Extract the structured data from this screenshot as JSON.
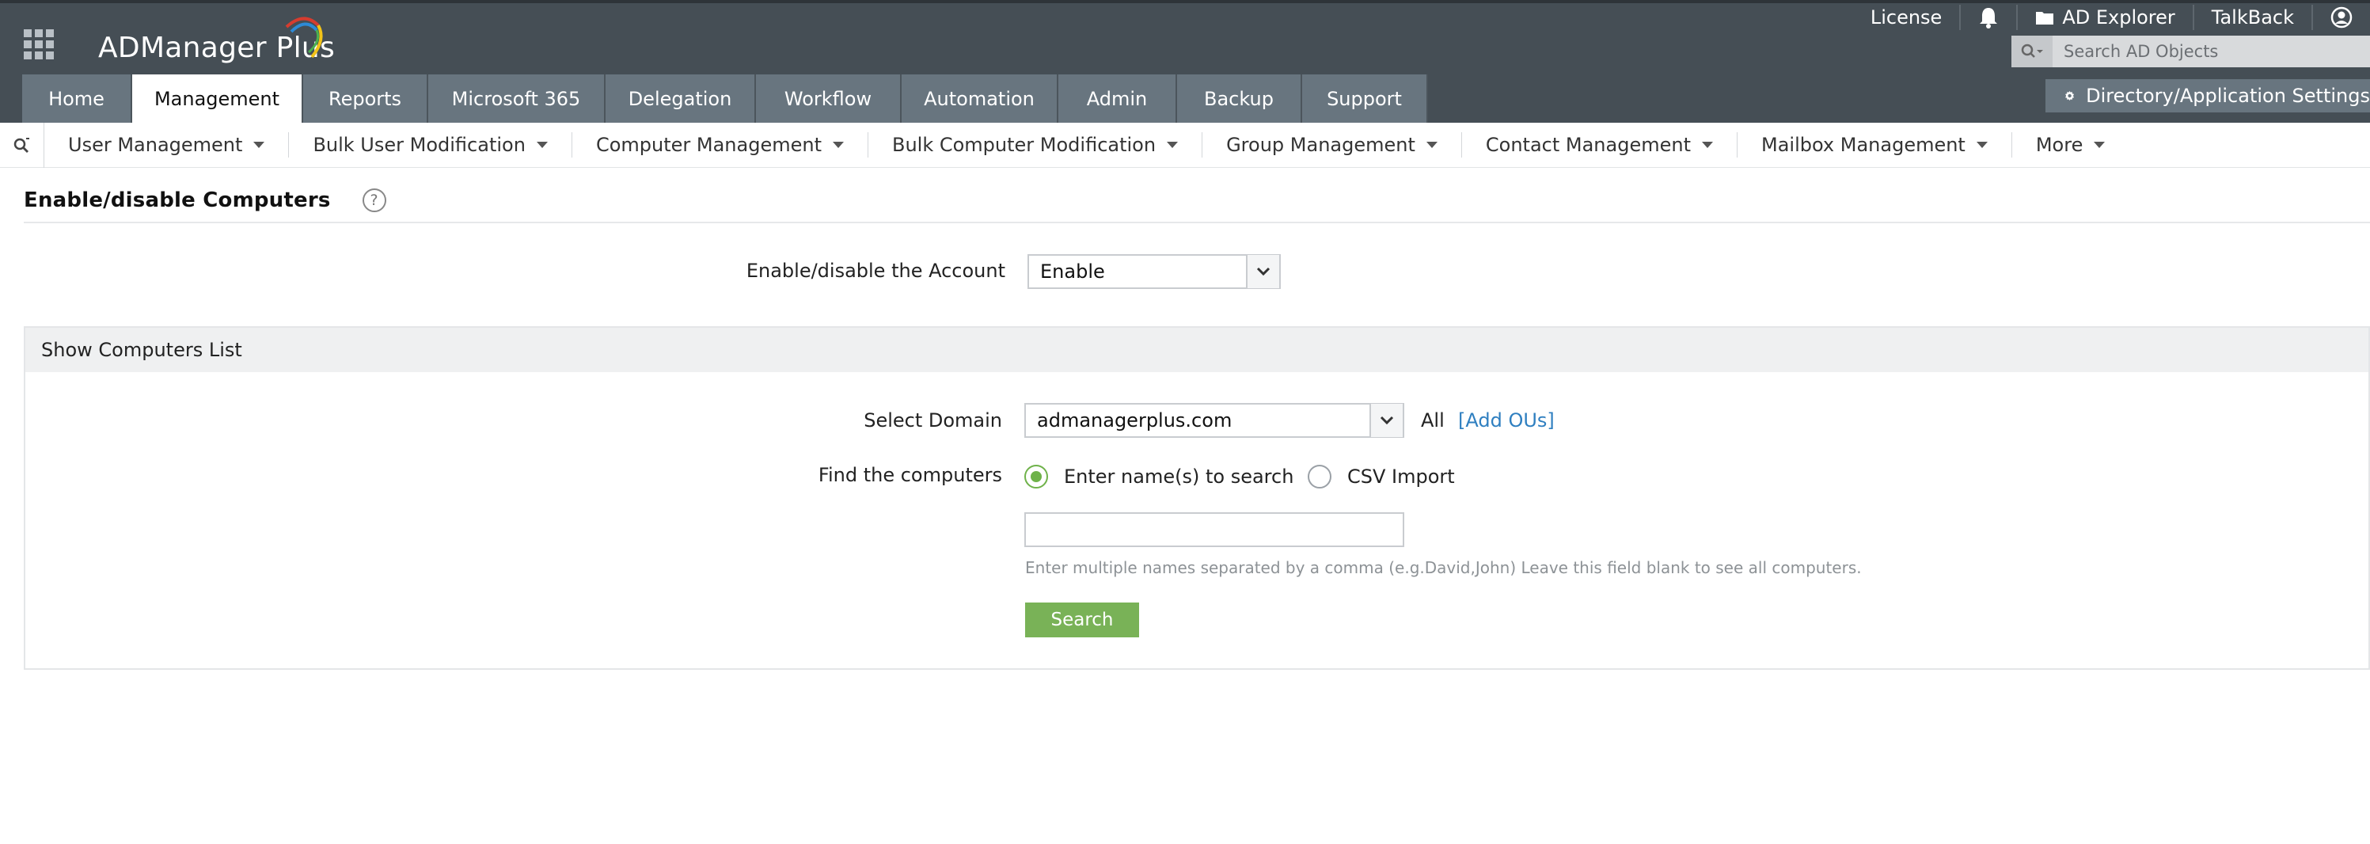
{
  "header": {
    "app_name": "ADManager Plus",
    "top_links": {
      "license": "License",
      "ad_explorer": "AD Explorer",
      "talkback": "TalkBack"
    },
    "search": {
      "placeholder": "Search AD Objects"
    },
    "tabs": [
      {
        "label": "Home",
        "active": false
      },
      {
        "label": "Management",
        "active": true
      },
      {
        "label": "Reports",
        "active": false
      },
      {
        "label": "Microsoft 365",
        "active": false
      },
      {
        "label": "Delegation",
        "active": false
      },
      {
        "label": "Workflow",
        "active": false
      },
      {
        "label": "Automation",
        "active": false
      },
      {
        "label": "Admin",
        "active": false
      },
      {
        "label": "Backup",
        "active": false
      },
      {
        "label": "Support",
        "active": false
      }
    ],
    "settings_label": "Directory/Application Settings"
  },
  "subnav": {
    "items": [
      "User Management",
      "Bulk User Modification",
      "Computer Management",
      "Bulk Computer Modification",
      "Group Management",
      "Contact Management",
      "Mailbox Management",
      "More"
    ]
  },
  "page": {
    "title": "Enable/disable Computers",
    "help_symbol": "?",
    "account_label": "Enable/disable the Account",
    "account_value": "Enable"
  },
  "panel": {
    "title": "Show Computers List",
    "domain_label": "Select Domain",
    "domain_value": "admanagerplus.com",
    "all_label": "All",
    "add_ous": "[Add OUs]",
    "find_label": "Find the computers",
    "option_names": "Enter name(s) to search",
    "option_csv": "CSV Import",
    "names_value": "",
    "hint": "Enter multiple names separated by a comma (e.g.David,John) Leave this field blank to see all computers.",
    "search_button": "Search"
  },
  "colors": {
    "header_bg": "#454e55",
    "tab_bg": "#68757f",
    "accent_green": "#79b257",
    "link_blue": "#2f7fc0"
  }
}
